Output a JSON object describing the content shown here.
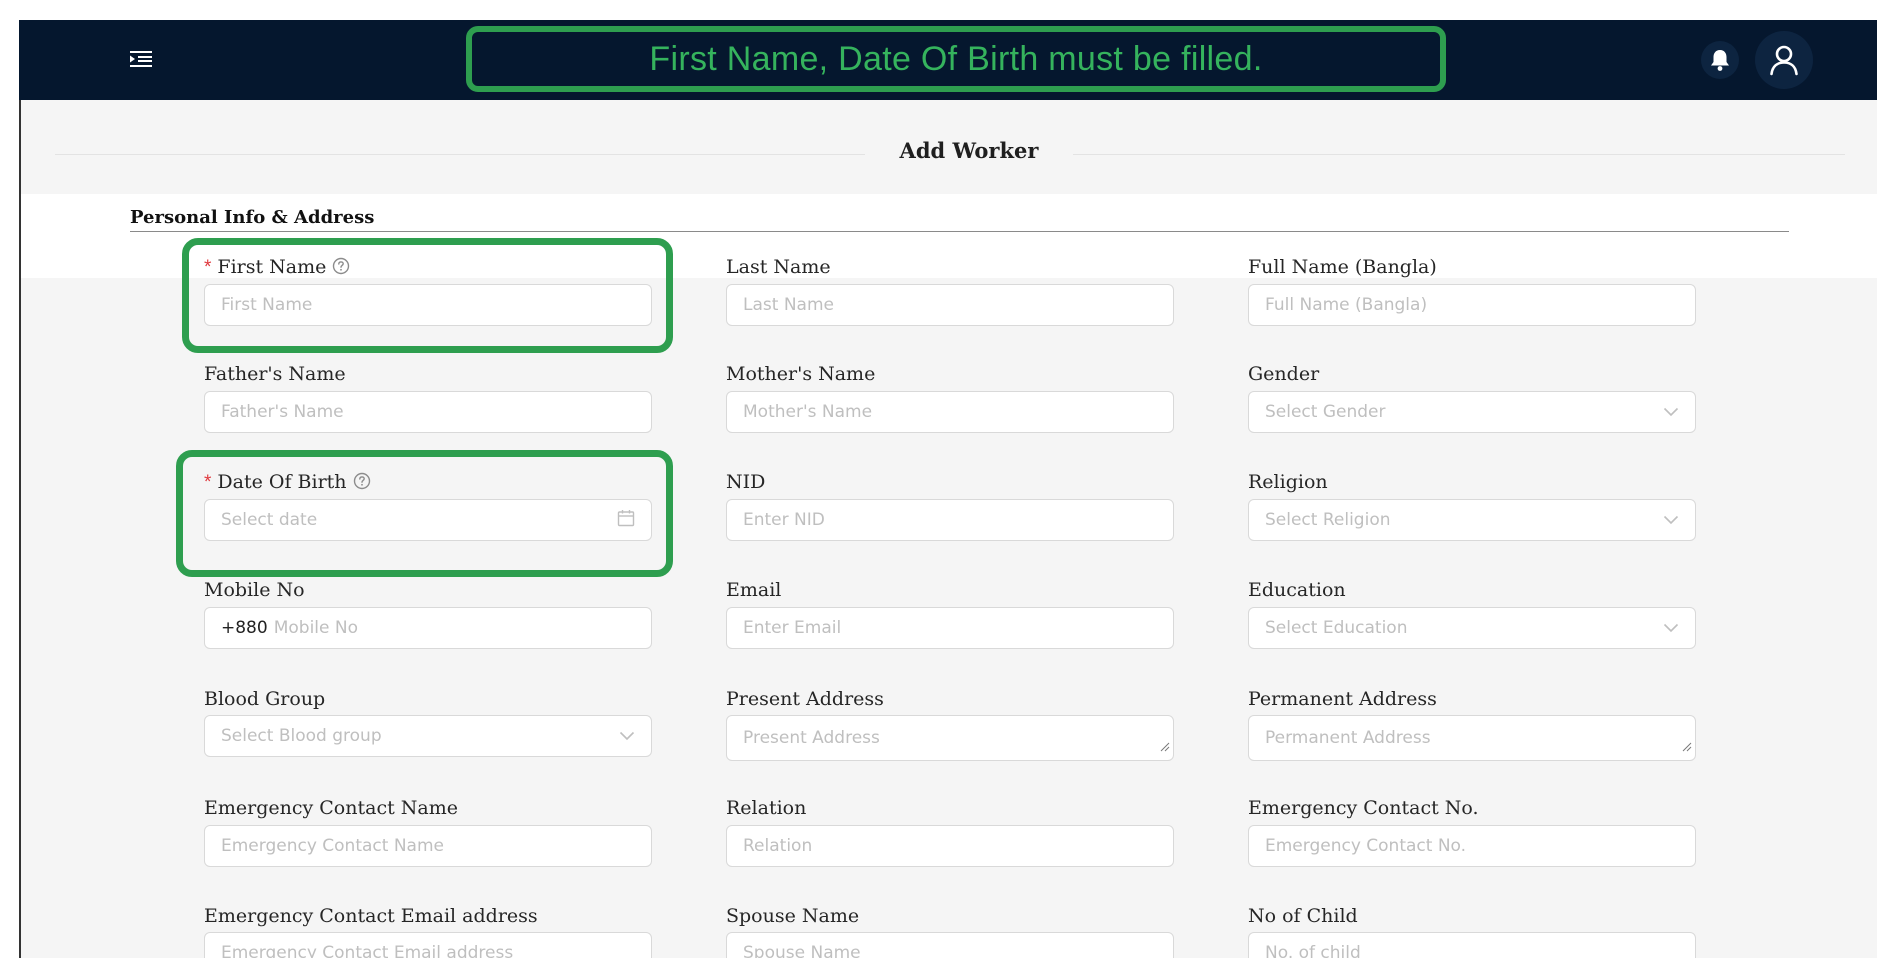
{
  "alert": {
    "message": "First Name, Date Of Birth must be filled.",
    "color": "#35b35d"
  },
  "header": {
    "menu_icon": "menu-fold-icon",
    "notification_icon": "bell-icon",
    "user_icon": "user-icon",
    "bar_color": "#05172e"
  },
  "page": {
    "title": "Add Worker"
  },
  "section": {
    "title": "Personal Info & Address"
  },
  "fields": {
    "first_name": {
      "label": "First Name",
      "placeholder": "First Name",
      "required": true
    },
    "last_name": {
      "label": "Last Name",
      "placeholder": "Last Name"
    },
    "full_name_bangla": {
      "label": "Full Name (Bangla)",
      "placeholder": "Full Name (Bangla)"
    },
    "fathers_name": {
      "label": "Father's Name",
      "placeholder": "Father's Name"
    },
    "mothers_name": {
      "label": "Mother's Name",
      "placeholder": "Mother's Name"
    },
    "gender": {
      "label": "Gender",
      "placeholder": "Select Gender"
    },
    "date_of_birth": {
      "label": "Date Of Birth",
      "placeholder": "Select date",
      "required": true
    },
    "nid": {
      "label": "NID",
      "placeholder": "Enter NID"
    },
    "religion": {
      "label": "Religion",
      "placeholder": "Select Religion"
    },
    "mobile_no": {
      "label": "Mobile No",
      "prefix": "+880",
      "placeholder": "Mobile No"
    },
    "email": {
      "label": "Email",
      "placeholder": "Enter Email"
    },
    "education": {
      "label": "Education",
      "placeholder": "Select Education"
    },
    "blood_group": {
      "label": "Blood Group",
      "placeholder": "Select Blood group"
    },
    "present_address": {
      "label": "Present Address",
      "placeholder": "Present Address"
    },
    "permanent_address": {
      "label": "Permanent Address",
      "placeholder": "Permanent Address"
    },
    "emergency_contact_name": {
      "label": "Emergency Contact Name",
      "placeholder": "Emergency Contact Name"
    },
    "relation": {
      "label": "Relation",
      "placeholder": "Relation"
    },
    "emergency_contact_no": {
      "label": "Emergency Contact No.",
      "placeholder": "Emergency Contact No."
    },
    "emergency_contact_email": {
      "label": "Emergency Contact Email address",
      "placeholder": "Emergency Contact Email address"
    },
    "spouse_name": {
      "label": "Spouse Name",
      "placeholder": "Spouse Name"
    },
    "no_of_child": {
      "label": "No of Child",
      "placeholder": "No. of child"
    }
  },
  "colors": {
    "required_mark": "#e0393e",
    "highlight": "#2e9e4f"
  }
}
